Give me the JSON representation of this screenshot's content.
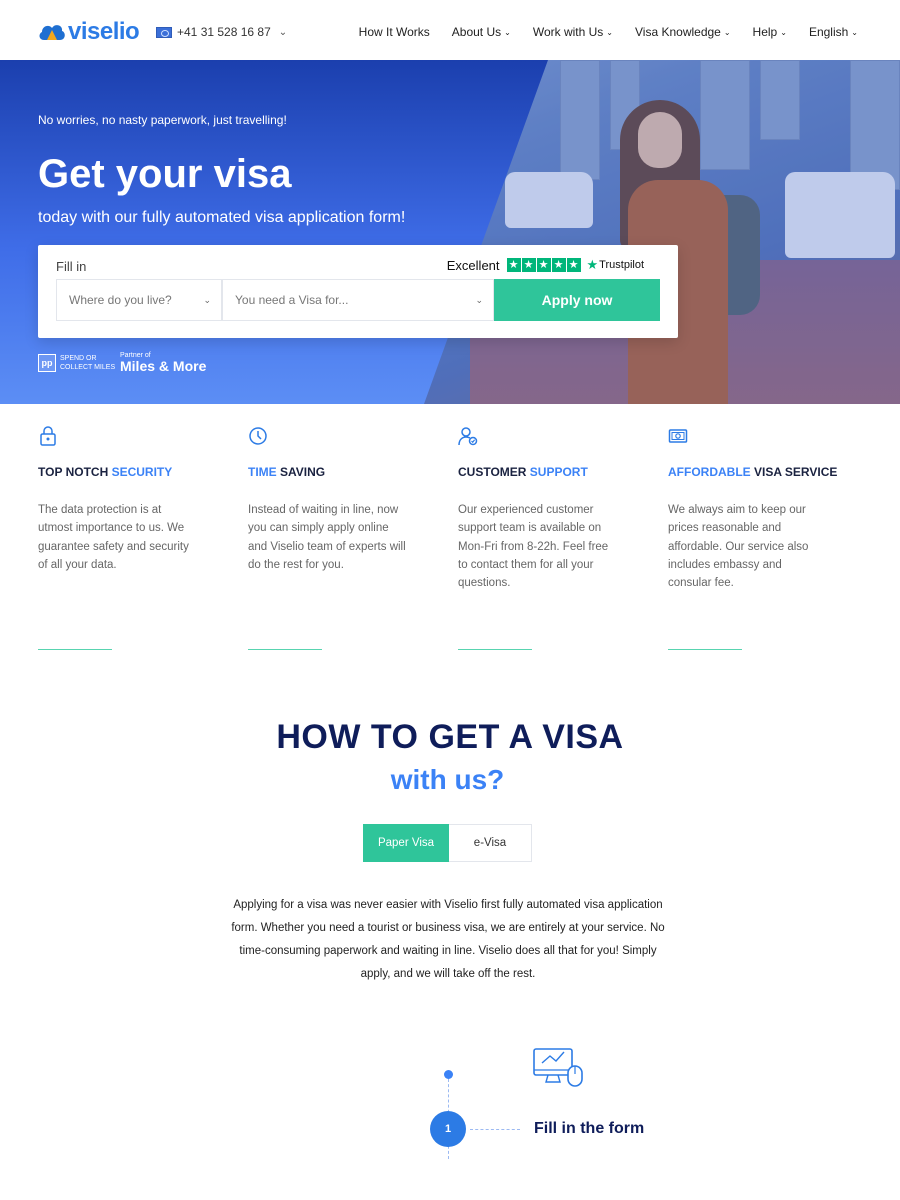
{
  "header": {
    "logo_text": "viselio",
    "phone": "+41 31 528 16 87",
    "nav": [
      {
        "label": "How It Works",
        "dropdown": false
      },
      {
        "label": "About Us",
        "dropdown": true
      },
      {
        "label": "Work with Us",
        "dropdown": true
      },
      {
        "label": "Visa Knowledge",
        "dropdown": true
      },
      {
        "label": "Help",
        "dropdown": true
      },
      {
        "label": "English",
        "dropdown": true
      }
    ]
  },
  "hero": {
    "kicker": "No worries, no nasty paperwork, just travelling!",
    "title": "Get your visa",
    "subtitle": "today with our fully automated visa application form!",
    "form": {
      "fill_label": "Fill in",
      "rating_text": "Excellent",
      "rating_stars": 5,
      "trustpilot_label": "Trustpilot",
      "select_country_placeholder": "Where do you live?",
      "select_visa_placeholder": "You need a Visa for...",
      "apply_label": "Apply now"
    },
    "partner": {
      "pp": "pp",
      "pp_text": "SPEND OR COLLECT MILES",
      "partner_of": "Partner of",
      "name": "Miles & More"
    }
  },
  "features": [
    {
      "title_plain": "TOP NOTCH ",
      "title_highlight": "SECURITY",
      "title_after": "",
      "icon": "lock-icon",
      "desc": "The data protection is at utmost importance to us. We guarantee safety and security of all your data."
    },
    {
      "title_plain": "",
      "title_highlight": "TIME",
      "title_after": " SAVING",
      "icon": "clock-icon",
      "desc": "Instead of waiting in line, now you can simply apply online and Viselio team of experts will do the rest for you."
    },
    {
      "title_plain": "CUSTOMER ",
      "title_highlight": "SUPPORT",
      "title_after": "",
      "icon": "support-user-icon",
      "desc": "Our experienced customer support team is available on Mon-Fri from 8-22h. Feel free to contact them for all your questions."
    },
    {
      "title_plain": "",
      "title_highlight": "AFFORDABLE",
      "title_after": " VISA SERVICE",
      "icon": "money-icon",
      "desc": "We always aim to keep our prices reasonable and affordable. Our service also includes embassy and consular fee."
    }
  ],
  "howto": {
    "title": "HOW TO GET A VISA",
    "subtitle": "with us?",
    "tabs": [
      {
        "label": "Paper Visa",
        "active": true
      },
      {
        "label": "e-Visa",
        "active": false
      }
    ],
    "intro": "Applying for a visa was never easier with Viselio first fully automated visa application form. Whether you need a tourist or business visa, we are entirely at your service. No time-consuming paperwork and waiting in line. Viselio does all that for you! Simply apply, and we will take off the rest."
  },
  "steps": [
    {
      "number": "1",
      "label": "Fill in the form",
      "icon": "computer-form-icon"
    }
  ],
  "colors": {
    "brand_blue": "#2c7be5",
    "accent_green": "#2fc59a",
    "navy": "#0f1d5a",
    "highlight_blue": "#3b82f6",
    "trustpilot_green": "#00b67a"
  }
}
